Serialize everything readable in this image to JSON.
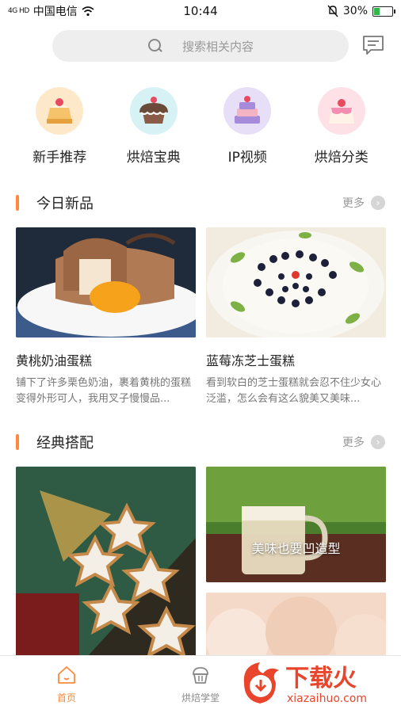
{
  "status_bar": {
    "signal_text": "4G HD",
    "carrier": "中国电信",
    "time": "10:44",
    "battery": "30%",
    "battery_level": 0.3
  },
  "search": {
    "placeholder": "搜索相关内容"
  },
  "categories": [
    {
      "label": "新手推荐",
      "icon": "cake-slice-icon",
      "bg": "#fde9c9"
    },
    {
      "label": "烘焙宝典",
      "icon": "cupcake-icon",
      "bg": "#d7f2f5"
    },
    {
      "label": "IP视频",
      "icon": "layer-cake-icon",
      "bg": "#e7def7"
    },
    {
      "label": "烘焙分类",
      "icon": "pudding-icon",
      "bg": "#fde1e6"
    }
  ],
  "sections": {
    "new": {
      "title": "今日新品",
      "more": "更多"
    },
    "classic": {
      "title": "经典搭配",
      "more": "更多"
    }
  },
  "new_items": [
    {
      "title": "黄桃奶油蛋糕",
      "desc": "铺下了许多栗色奶油，裹着黄桃的蛋糕变得外形可人，我用叉子慢慢品..."
    },
    {
      "title": "蓝莓冻芝士蛋糕",
      "desc": "看到软白的芝士蛋糕就会忍不住少女心泛滥，怎么会有这么貌美又美味..."
    }
  ],
  "classic_items": {
    "caption": "美味也要凹造型"
  },
  "tab_bar": {
    "home": "首页",
    "school": "烘焙学堂"
  },
  "watermark": {
    "name": "下载火",
    "url": "xiazaihuo.com"
  },
  "colors": {
    "accent": "#ff8a3d"
  }
}
